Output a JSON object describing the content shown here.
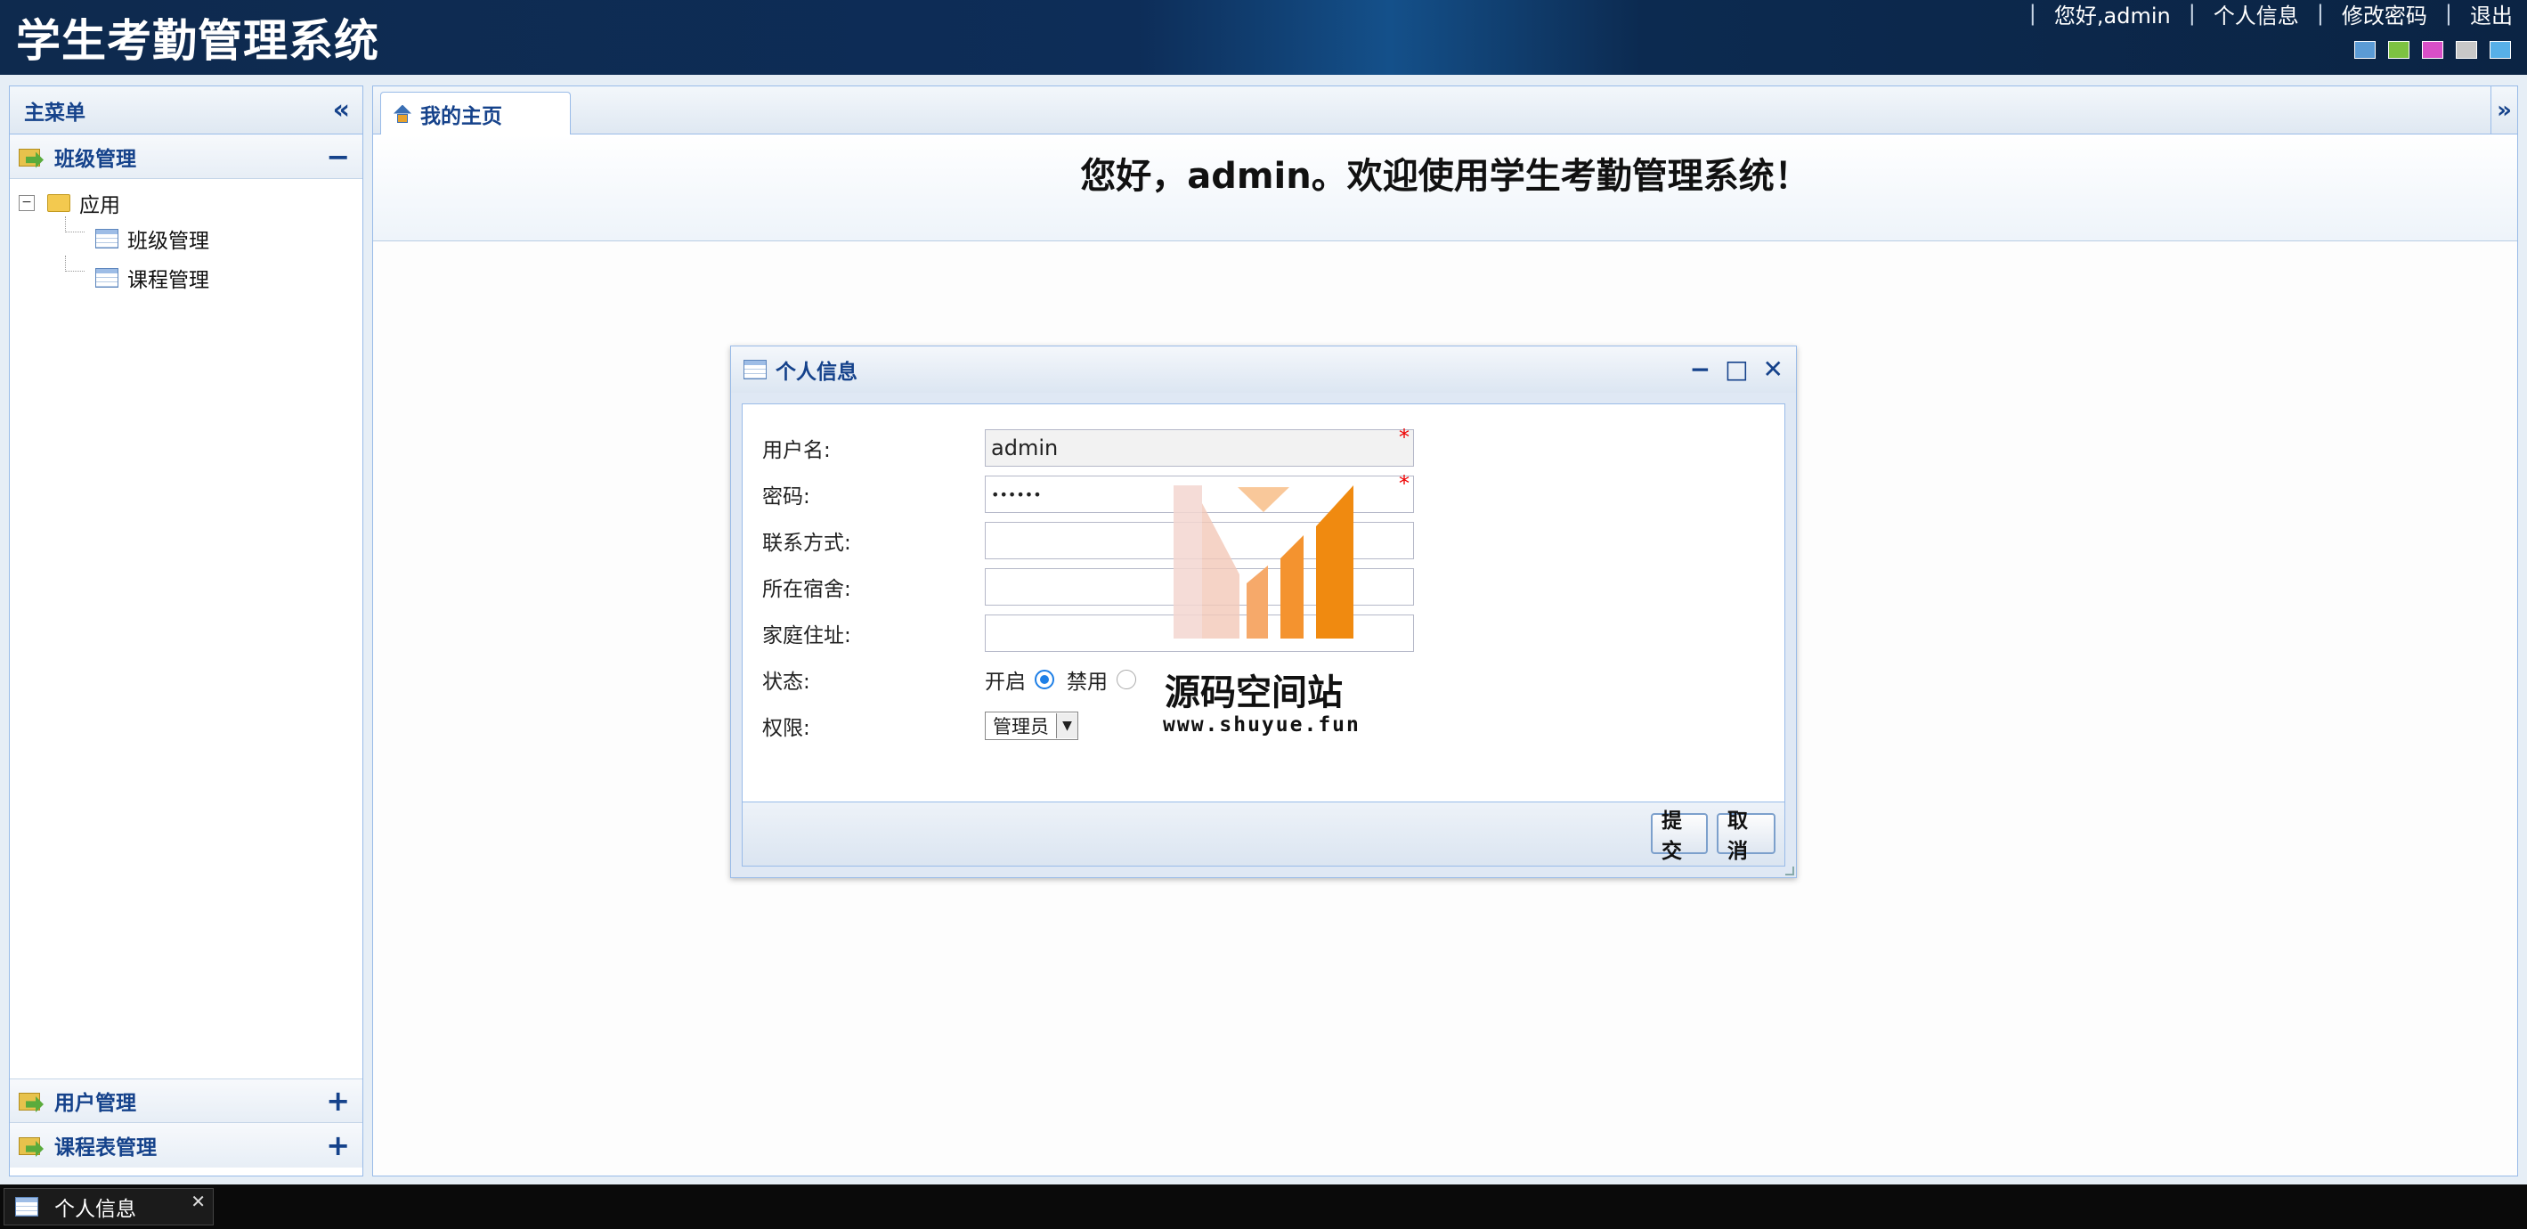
{
  "header": {
    "title": "学生考勤管理系统",
    "greeting": "您好,admin",
    "nav": {
      "profile": "个人信息",
      "change_password": "修改密码",
      "logout": "退出"
    },
    "separator": "|",
    "theme_colors": [
      "#5b9bd5",
      "#7dc242",
      "#d84fc8",
      "#c8c8c8",
      "#57b0e8"
    ]
  },
  "sidebar": {
    "title": "主菜单",
    "collapse_glyph": "«",
    "panels": [
      {
        "label": "班级管理",
        "tool": "−"
      },
      {
        "label": "用户管理",
        "tool": "+"
      },
      {
        "label": "课程表管理",
        "tool": "+"
      }
    ],
    "tree": {
      "root": "应用",
      "root_toggle": "−",
      "children": [
        "班级管理",
        "课程管理"
      ]
    }
  },
  "main": {
    "tab": "我的主页",
    "tab_scroll_glyph": "»",
    "welcome": "您好，admin。欢迎使用学生考勤管理系统！"
  },
  "dialog": {
    "title": "个人信息",
    "tools": {
      "minimize": "−",
      "maximize": "□",
      "close": "✕"
    },
    "required_mark": "*",
    "fields": {
      "username": {
        "label": "用户名:",
        "value": "admin"
      },
      "password": {
        "label": "密码:",
        "value": "••••••"
      },
      "contact": {
        "label": "联系方式:",
        "value": ""
      },
      "dorm": {
        "label": "所在宿舍:",
        "value": ""
      },
      "address": {
        "label": "家庭住址:",
        "value": ""
      },
      "status": {
        "label": "状态:",
        "options": [
          "开启",
          "禁用"
        ],
        "selected": "开启"
      },
      "role": {
        "label": "权限:",
        "value": "管理员",
        "arrow": "▼"
      }
    },
    "buttons": {
      "submit": "提交",
      "cancel": "取消"
    }
  },
  "watermark": {
    "name": "源码空间站",
    "url": "www.shuyue.fun"
  },
  "taskbar": {
    "item": "个人信息",
    "close": "✕"
  }
}
